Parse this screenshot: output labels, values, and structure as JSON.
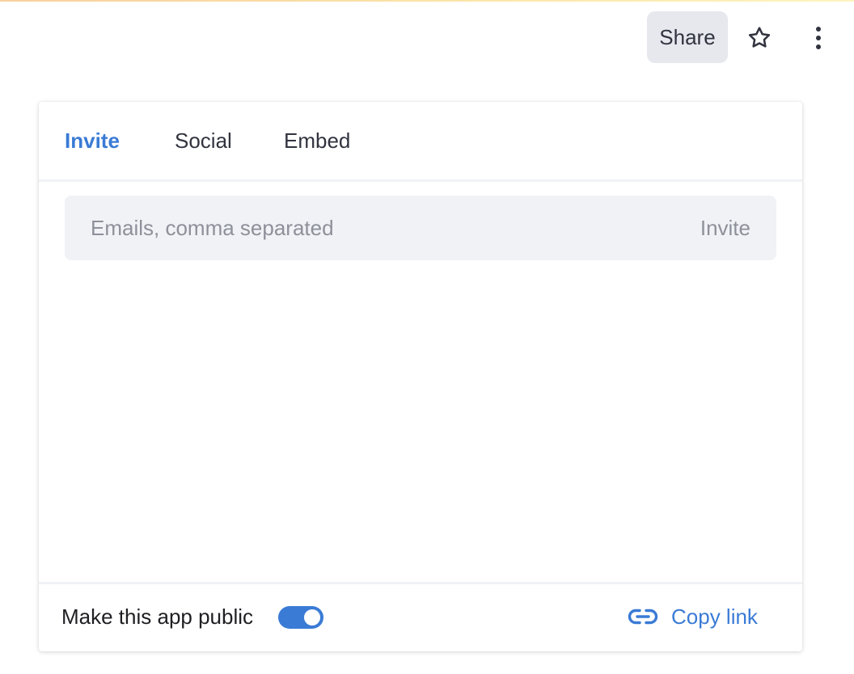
{
  "header": {
    "share_label": "Share"
  },
  "share_panel": {
    "tabs": [
      {
        "label": "Invite",
        "active": true
      },
      {
        "label": "Social",
        "active": false
      },
      {
        "label": "Embed",
        "active": false
      }
    ],
    "invite": {
      "email_placeholder": "Emails, comma separated",
      "email_value": "",
      "submit_label": "Invite"
    },
    "footer": {
      "public_label": "Make this app public",
      "public_enabled": true,
      "copy_link_label": "Copy link"
    }
  },
  "colors": {
    "accent": "#3a7bd5",
    "input_background": "#f0f2f6",
    "share_button_background": "#e6e8ee",
    "placeholder_text": "#8e909a"
  },
  "icons": {
    "star": "star-icon",
    "more": "more-vertical-icon",
    "link": "link-icon"
  }
}
